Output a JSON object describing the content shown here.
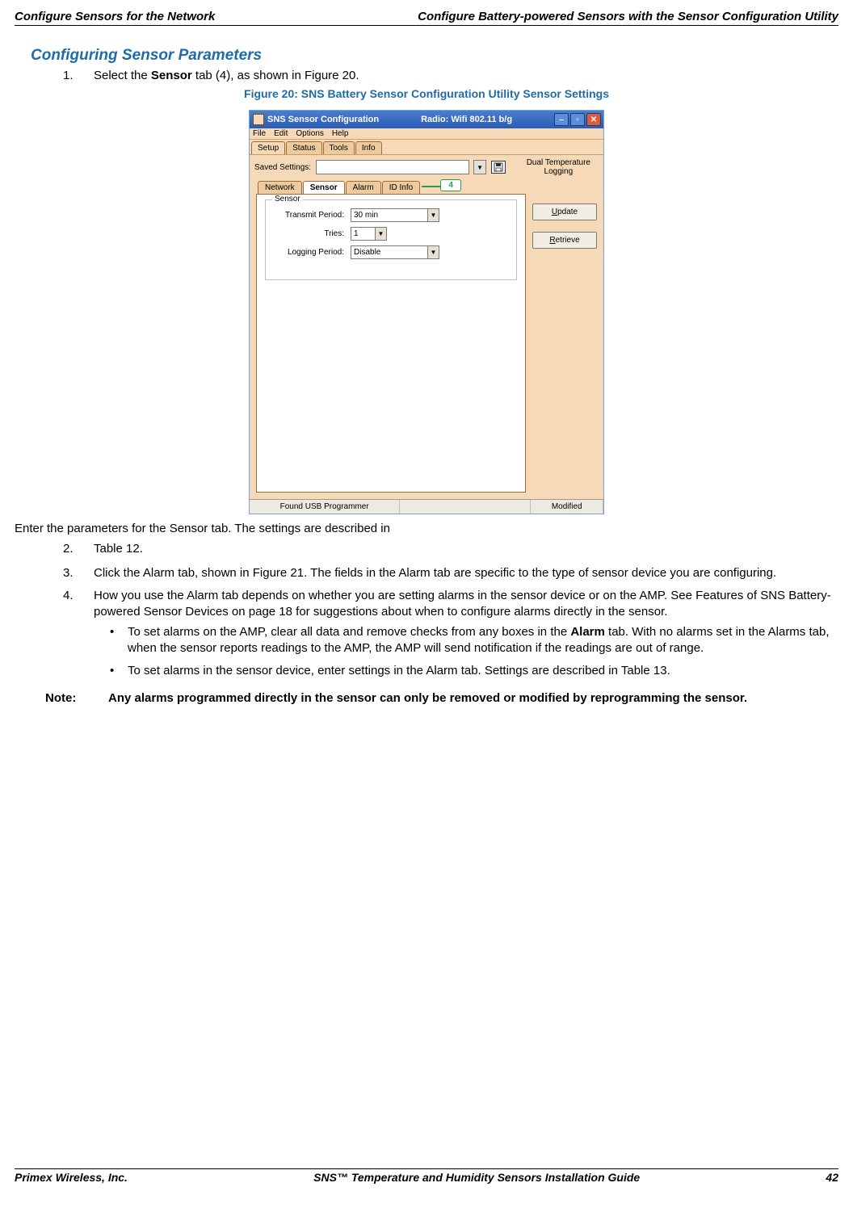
{
  "header": {
    "left": "Configure Sensors for the Network",
    "right": "Configure Battery-powered Sensors with the Sensor Configuration Utility"
  },
  "section_title": "Configuring Sensor Parameters",
  "item1": {
    "num": "1.",
    "pre": "Select the ",
    "bold": "Sensor",
    "post": " tab (4), as shown in Figure 20."
  },
  "fig_caption": "Figure 20: SNS Battery Sensor Configuration Utility Sensor Settings",
  "shot": {
    "titlebar_app": "SNS Sensor Configuration",
    "titlebar_radio": "Radio: Wifi 802.11 b/g",
    "menu": {
      "file": "File",
      "edit": "Edit",
      "options": "Options",
      "help": "Help"
    },
    "ttabs": {
      "setup": "Setup",
      "status": "Status",
      "tools": "Tools",
      "info": "Info"
    },
    "saved_label": "Saved Settings:",
    "dual_temp1": "Dual Temperature",
    "dual_temp2": "Logging",
    "subtabs": {
      "network": "Network",
      "sensor": "Sensor",
      "alarm": "Alarm",
      "idinfo": "ID Info"
    },
    "callout": "4",
    "fieldset_legend": "Sensor",
    "row1_label": "Transmit Period:",
    "row1_value": "30 min",
    "row2_label": "Tries:",
    "row2_value": "1",
    "row3_label": "Logging Period:",
    "row3_value": "Disable",
    "btn_update": "Update",
    "btn_retrieve": "Retrieve",
    "status_found": "Found USB Programmer",
    "status_modified": "Modified"
  },
  "para_enter": "Enter the parameters for the Sensor tab. The settings are described in",
  "item2": {
    "num": "2.",
    "text": "Table 12."
  },
  "item3": {
    "num": "3.",
    "text": "Click the Alarm tab, shown in Figure 21. The fields in the Alarm tab are specific to the type of sensor device you are configuring."
  },
  "item4": {
    "num": "4.",
    "text": "How you use the Alarm tab depends on whether you are setting alarms in the sensor device or on the AMP. See Features of SNS Battery-powered Sensor Devices on page 18  for suggestions about when to configure alarms directly in the sensor."
  },
  "bullet1": {
    "pre": "To set alarms on the AMP, clear all data and remove checks from any boxes in the ",
    "bold": "Alarm",
    "post": " tab. With no alarms set in the Alarms tab, when the sensor reports readings to the AMP, the AMP will send notification if the readings are out of range."
  },
  "bullet2": "To set alarms in the sensor device, enter settings in the Alarm tab. Settings are described in Table 13.",
  "note_label": "Note:",
  "note_body": "Any alarms programmed directly in the sensor can only be removed or modified by reprogramming the sensor.",
  "footer": {
    "left": "Primex Wireless, Inc.",
    "center": "SNS™ Temperature and Humidity Sensors Installation Guide",
    "right": "42"
  }
}
